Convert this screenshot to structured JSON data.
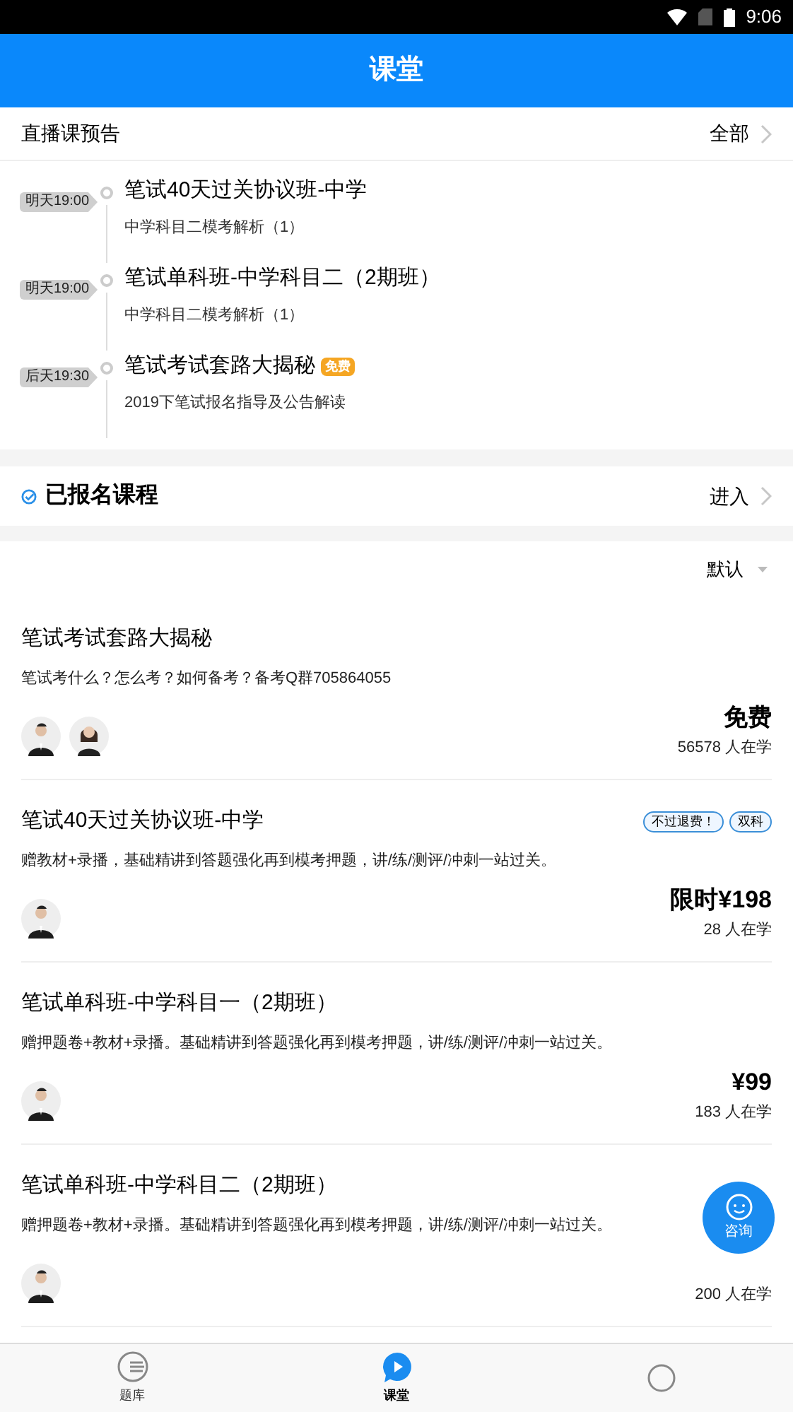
{
  "status_bar": {
    "time": "9:06"
  },
  "header": {
    "title": "课堂"
  },
  "live_preview": {
    "title": "直播课预告",
    "more": "全部",
    "items": [
      {
        "time": "明天19:00",
        "title": "笔试40天过关协议班-中学",
        "subtitle": "中学科目二模考解析（1）"
      },
      {
        "time": "明天19:00",
        "title": "笔试单科班-中学科目二（2期班）",
        "subtitle": "中学科目二模考解析（1）"
      },
      {
        "time": "后天19:30",
        "title": "笔试考试套路大揭秘",
        "badge": "免费",
        "subtitle": "2019下笔试报名指导及公告解读"
      }
    ]
  },
  "enrolled": {
    "title": "已报名课程",
    "action": "进入"
  },
  "sort": {
    "label": "默认"
  },
  "courses": [
    {
      "title": "笔试考试套路大揭秘",
      "description": "笔试考什么？怎么考？如何备考？备考Q群705864055",
      "avatars": [
        {
          "kind": "male"
        },
        {
          "kind": "female"
        }
      ],
      "price": "免费",
      "students": "56578 人在学"
    },
    {
      "title": "笔试40天过关协议班-中学",
      "tags": [
        "不过退费！",
        "双科"
      ],
      "description": "赠教材+录播，基础精讲到答题强化再到模考押题，讲/练/测评/冲刺一站过关。",
      "avatars": [
        {
          "kind": "male"
        }
      ],
      "price": "限时¥198",
      "students": "28 人在学"
    },
    {
      "title": "笔试单科班-中学科目一（2期班）",
      "description": "赠押题卷+教材+录播。基础精讲到答题强化再到模考押题，讲/练/测评/冲刺一站过关。",
      "avatars": [
        {
          "kind": "male"
        }
      ],
      "price": "¥99",
      "students": "183 人在学"
    },
    {
      "title": "笔试单科班-中学科目二（2期班）",
      "description": "赠押题卷+教材+录播。基础精讲到答题强化再到模考押题，讲/练/测评/冲刺一站过关。",
      "avatars": [
        {
          "kind": "male"
        }
      ],
      "students": "200 人在学"
    }
  ],
  "consult_button": {
    "label": "咨询"
  },
  "bottom_nav": [
    {
      "kind": "bank",
      "label": "题库",
      "selected": false
    },
    {
      "kind": "class",
      "label": "课堂",
      "selected": true
    },
    {
      "kind": "profile",
      "selected": false
    }
  ]
}
